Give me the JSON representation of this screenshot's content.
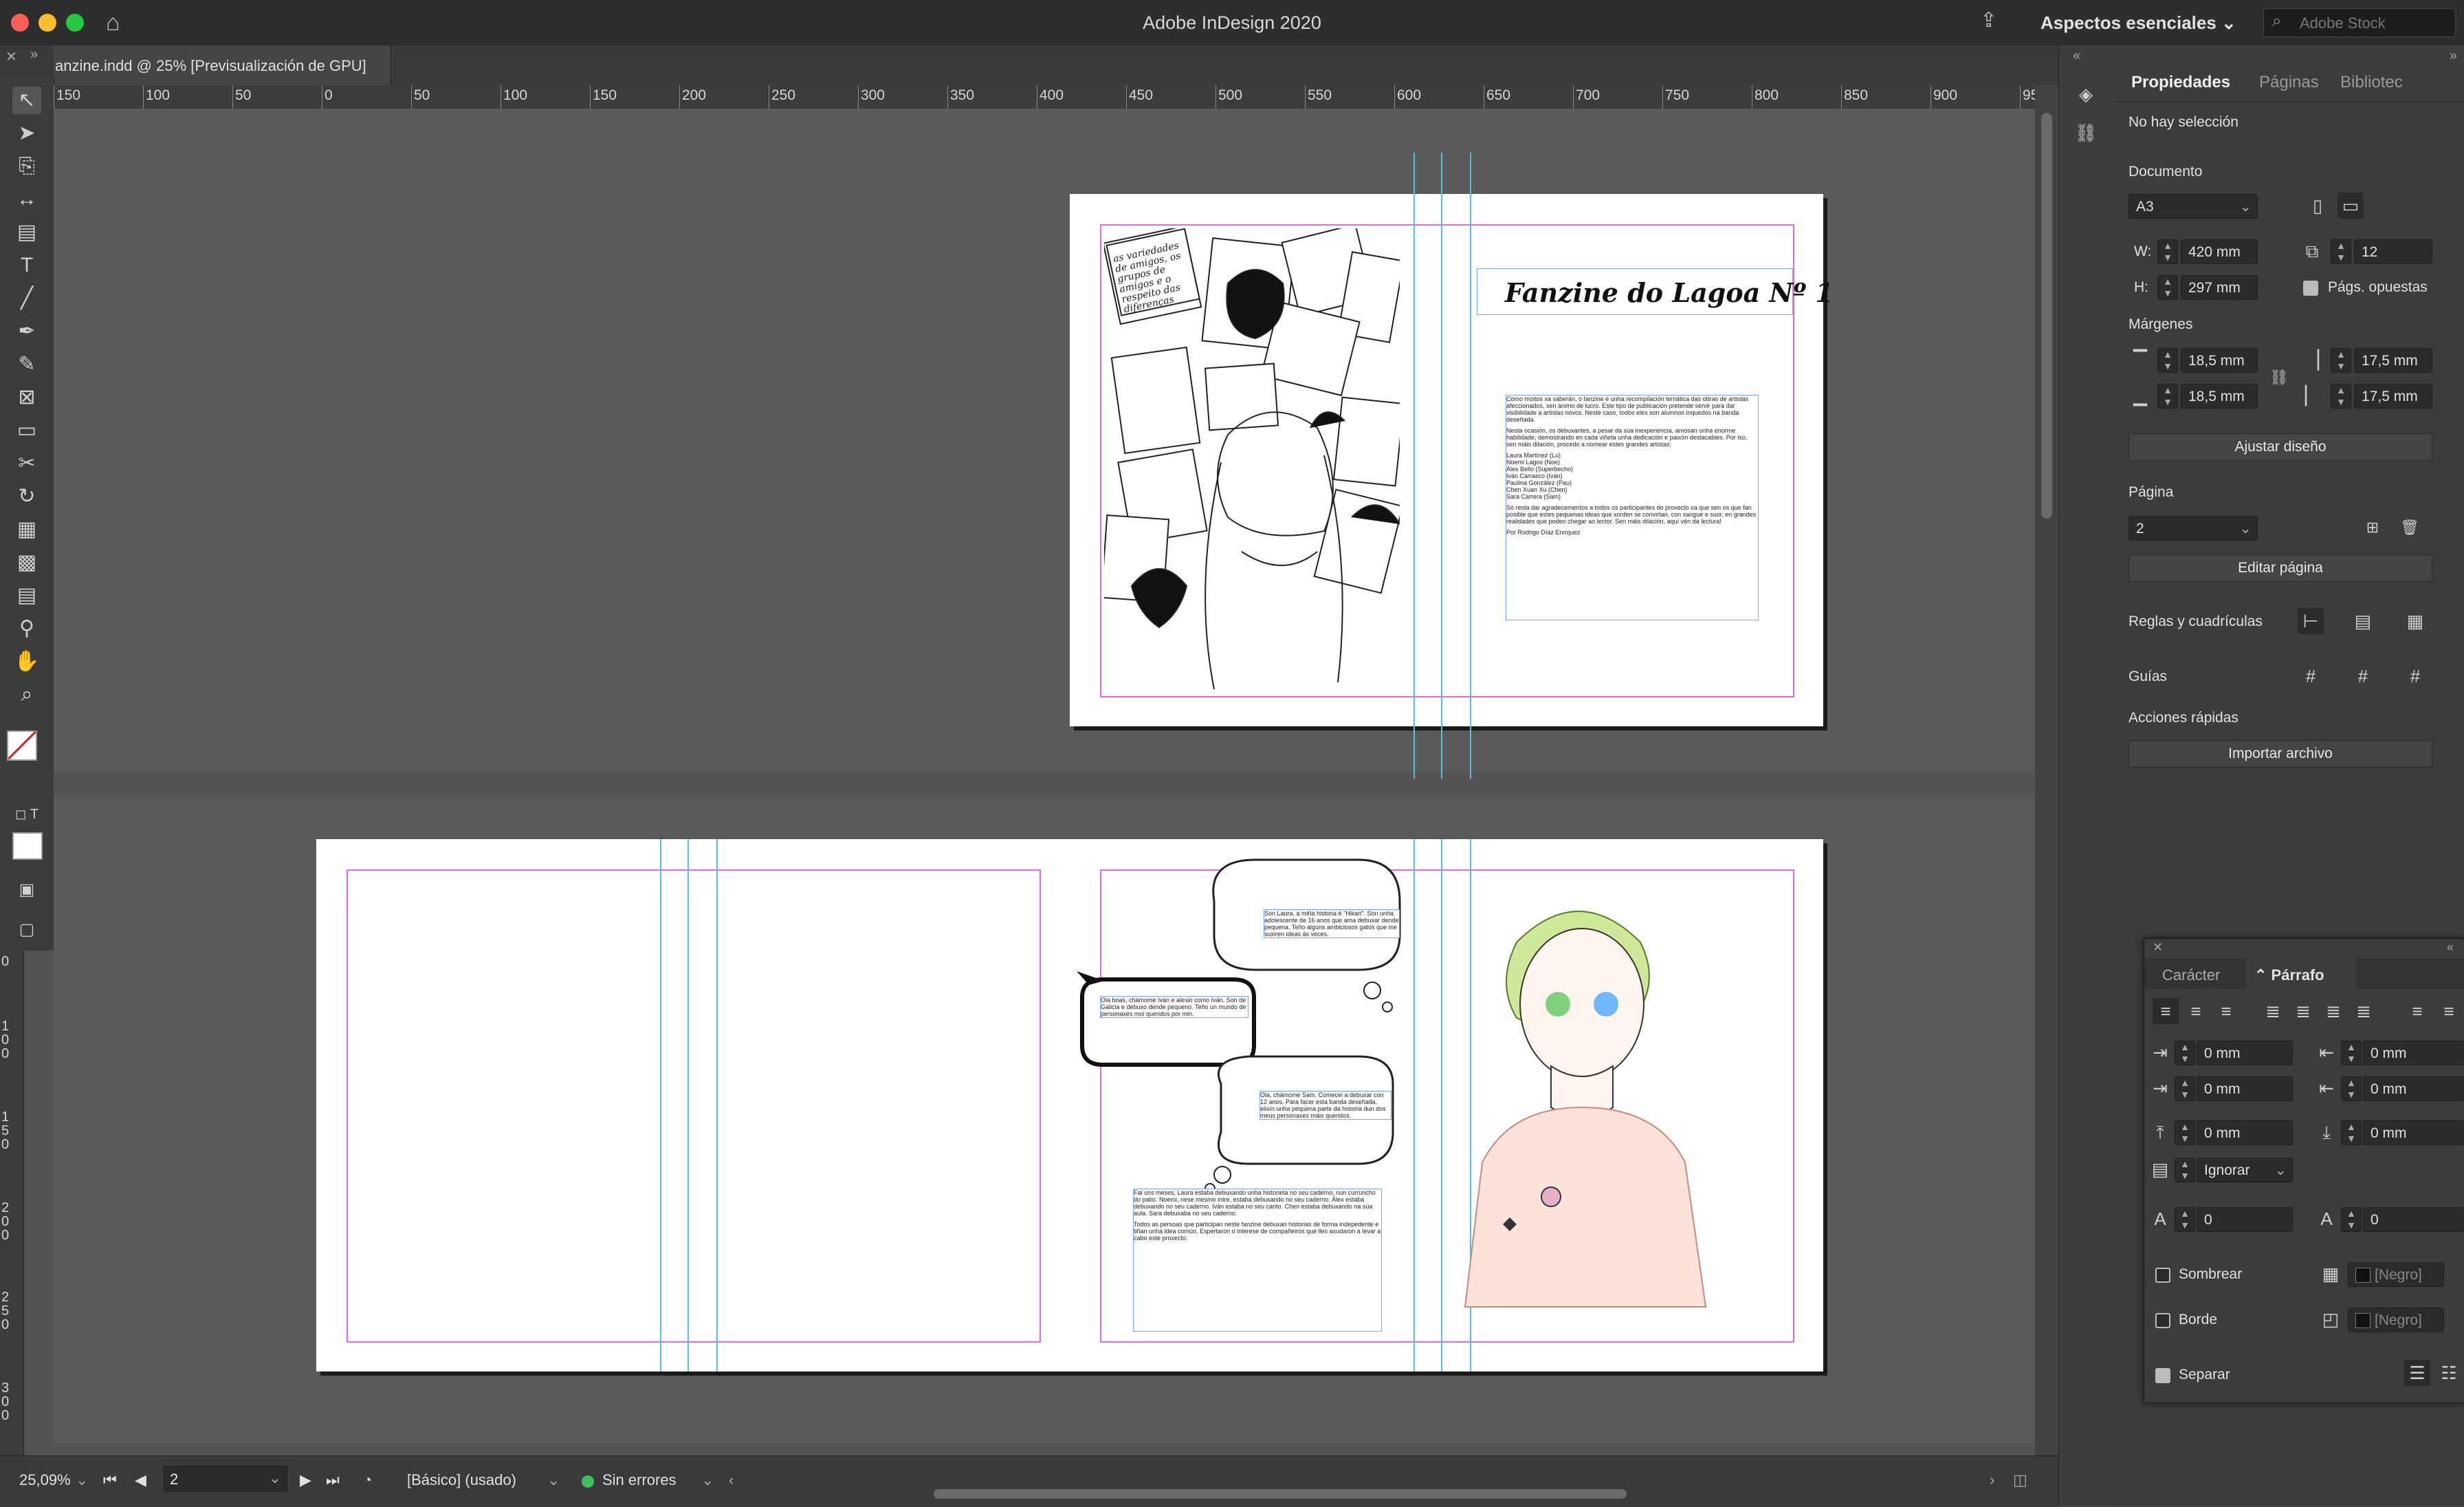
{
  "app": {
    "title": "Adobe InDesign 2020",
    "workspace": "Aspectos esenciales",
    "stock_placeholder": "Adobe Stock"
  },
  "document": {
    "tab_title": "anzine.indd @ 25% [Previsualización de GPU]"
  },
  "ruler": {
    "h_labels": [
      "150",
      "100",
      "50",
      "0",
      "50",
      "100",
      "150",
      "200",
      "250",
      "300",
      "350",
      "400",
      "450",
      "500",
      "550",
      "600",
      "650",
      "700",
      "750",
      "800",
      "850",
      "900",
      "95"
    ],
    "v_labels": [
      "0",
      "100",
      "150",
      "200",
      "250",
      "300"
    ]
  },
  "spread1": {
    "title": "Fanzine do Lagoa Nº 1",
    "left_caption": "as variedades de amigos, os grupos de amigos e o respeito das diferenças",
    "intro_paragraphs": [
      "Como moitos xa saberán, o fanzine é unha recompilación temática das obras de artistas afeccionados, sen ánimo de lucro. Este tipo de publicación pretende servir para dar visibilidade a artistas novos. Neste caso, todos eles son alumnos inquedos na banda deseñada.",
      "Nesta ocasión, os debuxantes, a pesar da súa inexperiencia, amosan unha enorme habilidade, demostrando en cada viñeta unha dedicación e paixón destacables. Por iso, sen máis dilación, procedo a nomear estes grandes artistas:",
      "Laura Martínez (Lu)\nNoemi Lagos (Noe)\nÁlex Bello (Superbecho)\nIván Carrasco (Iván)\nPaulina González (Pau)\nChen Xuan Xu (Chen)\nSara Carrera (Sam)",
      "Só resta dar agradecementos a todos os participantes do proxecto xa que sen os que fan posible que estes pequenas ideas que xorden se convirtan, con sangue e suor, en grandes realidades que poden chegar ao lector. Sen máis dilación, aquí vén da lectura!",
      "Por Rodrigo Díaz Enríquez"
    ]
  },
  "spread2": {
    "bubbles": [
      "Son Laura, a miña historia é \"Hikari\". Son unha adolescente de 16 anos que ama debuxar dende pequena. Teño algúns ambiciosos gatos que me suxiren ideas ás veces.",
      "Ola boas, chámome Iván e alesio como Iván. Son de Galicia e debuxo dende pequeno. Teño un mundo de personaxes moi queridos por min.",
      "Ola, chámome Sam. Comecei a debuxar con 12 anos. Para facer esta banda deseñada, elixín unha pequena parte da historia dun dos meus personaxes máis queridos."
    ],
    "story_paragraphs": [
      "Fai uns meses, Laura estaba debuxando unha historieta no seu caderno, nun curruncho do patio. Noemi, nese mesmo intre, estaba debuxando no seu caderno. Álex estaba debuxando no seu caderno. Iván estaba no seu canto. Chen estaba debuxando na súa aula. Sara debuxaba no seu caderno.",
      "Todos as persoas que participan neste fanzine debuxan historias de forma indepedente e tiñan unha idea común. Espertaron o interese de compañeiros que lles axudaron a levar a cabo este proxecto."
    ]
  },
  "status": {
    "zoom": "25,09%",
    "page": "2",
    "style": "[Básico] (usado)",
    "errors": "Sin errores"
  },
  "properties": {
    "tabs": [
      "Propiedades",
      "Páginas",
      "Bibliotec"
    ],
    "no_selection": "No hay selección",
    "document_label": "Documento",
    "page_size": "A3",
    "w_label": "W:",
    "w_value": "420 mm",
    "h_label": "H:",
    "h_value": "297 mm",
    "pages_count": "12",
    "facing_pages": "Págs. opuestas",
    "margins_label": "Márgenes",
    "margin_top": "18,5 mm",
    "margin_bottom": "18,5 mm",
    "margin_inside": "17,5 mm",
    "margin_outside": "17,5 mm",
    "adjust_layout": "Ajustar diseño",
    "page_label": "Página",
    "page_value": "2",
    "edit_page": "Editar página",
    "rulers_label": "Reglas y cuadrículas",
    "guides_label": "Guías",
    "quick_actions": "Acciones rápidas",
    "import_file": "Importar archivo"
  },
  "paragraph_panel": {
    "tab_character": "Carácter",
    "tab_paragraph": "Párrafo",
    "left_indent": "0 mm",
    "right_indent": "0 mm",
    "first_line": "0 mm",
    "last_line": "0 mm",
    "space_before": "0 mm",
    "space_after": "0 mm",
    "align_grid": "Ignorar",
    "drop_cap_lines": "0",
    "drop_cap_chars": "0",
    "shading": "Sombrear",
    "border": "Borde",
    "color_shading": "[Negro]",
    "color_border": "[Negro]",
    "split": "Separar"
  },
  "colors": {
    "accent_margin": "#e06ae0",
    "guide": "#52c3d6",
    "status_ok": "#3fbf5f"
  }
}
